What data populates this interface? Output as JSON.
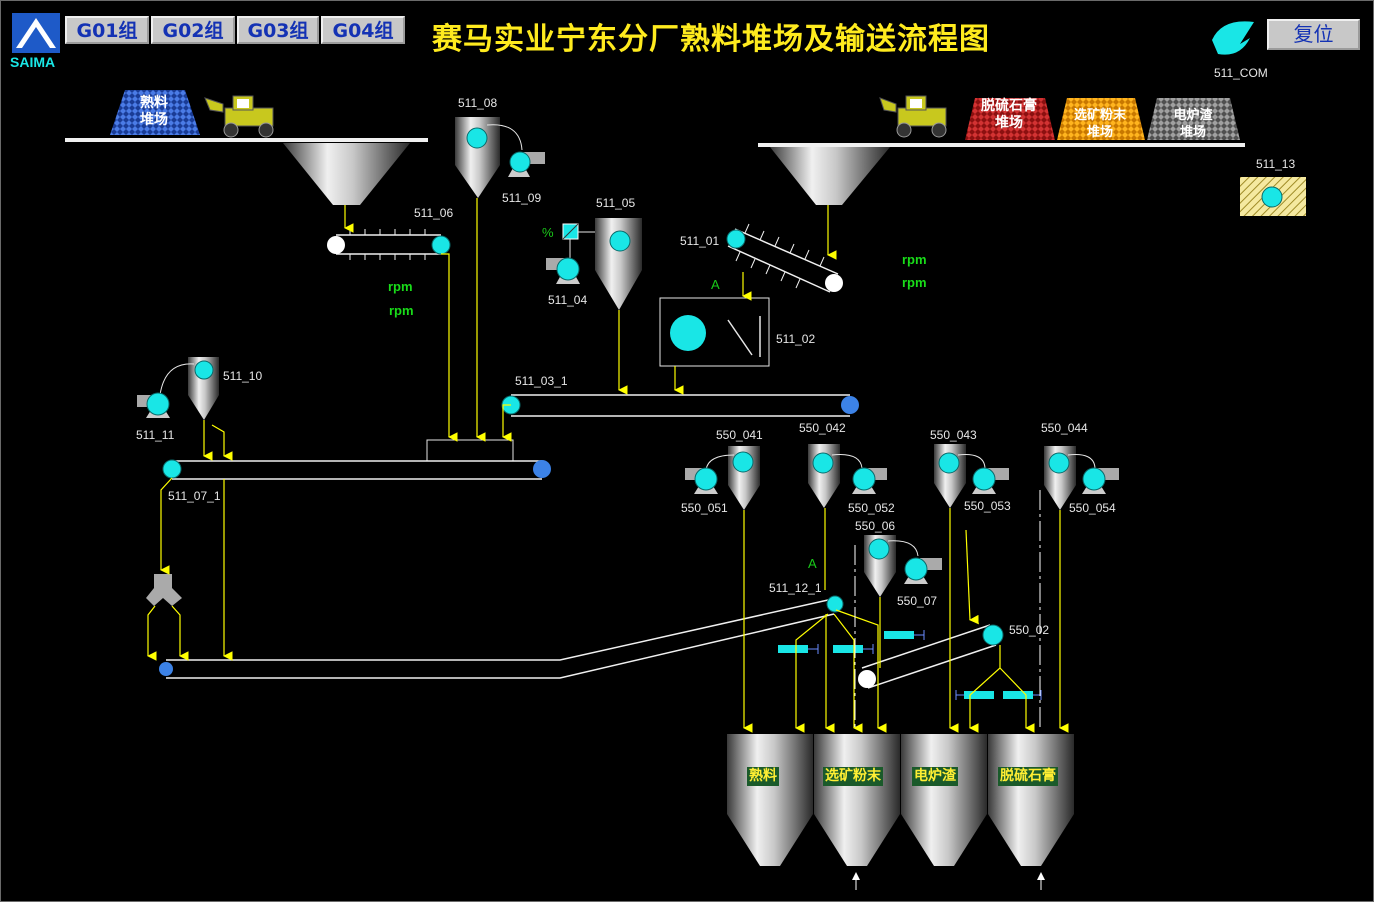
{
  "header": {
    "title": "赛马实业宁东分厂熟料堆场及输送流程图",
    "logo_text": "SAIMA",
    "group_buttons": [
      "G01组",
      "G02组",
      "G03组",
      "G04组"
    ],
    "reset_label": "复位",
    "com_tag": "511_COM"
  },
  "piles": {
    "clinker": "熟料\n堆场",
    "gypsum": "脱硫石膏\n堆场",
    "ore_powder": "选矿粉末\n堆场",
    "furnace_slag": "电炉渣\n堆场"
  },
  "speed_unit": "rpm",
  "current_mark": "A",
  "percent_mark": "%",
  "equipment_tags": {
    "t511_08": "511_08",
    "t511_09": "511_09",
    "t511_06": "511_06",
    "t511_05": "511_05",
    "t511_04": "511_04",
    "t511_01": "511_01",
    "t511_02": "511_02",
    "t511_13": "511_13",
    "t511_10": "511_10",
    "t511_11": "511_11",
    "t511_03_1": "511_03_1",
    "t511_07_1": "511_07_1",
    "t550_041": "550_041",
    "t550_042": "550_042",
    "t550_043": "550_043",
    "t550_044": "550_044",
    "t550_051": "550_051",
    "t550_052": "550_052",
    "t550_053": "550_053",
    "t550_054": "550_054",
    "t550_06": "550_06",
    "t550_07": "550_07",
    "t511_12_1": "511_12_1",
    "t550_02": "550_02"
  },
  "silos": {
    "clinker": "熟料",
    "ore_powder": "选矿粉末",
    "furnace_slag": "电炉渣",
    "gypsum": "脱硫石膏"
  },
  "colors": {
    "motor": "#19e6e6",
    "flow": "#ffff00",
    "title": "#ffeb1e",
    "status_text": "#19dc19"
  }
}
